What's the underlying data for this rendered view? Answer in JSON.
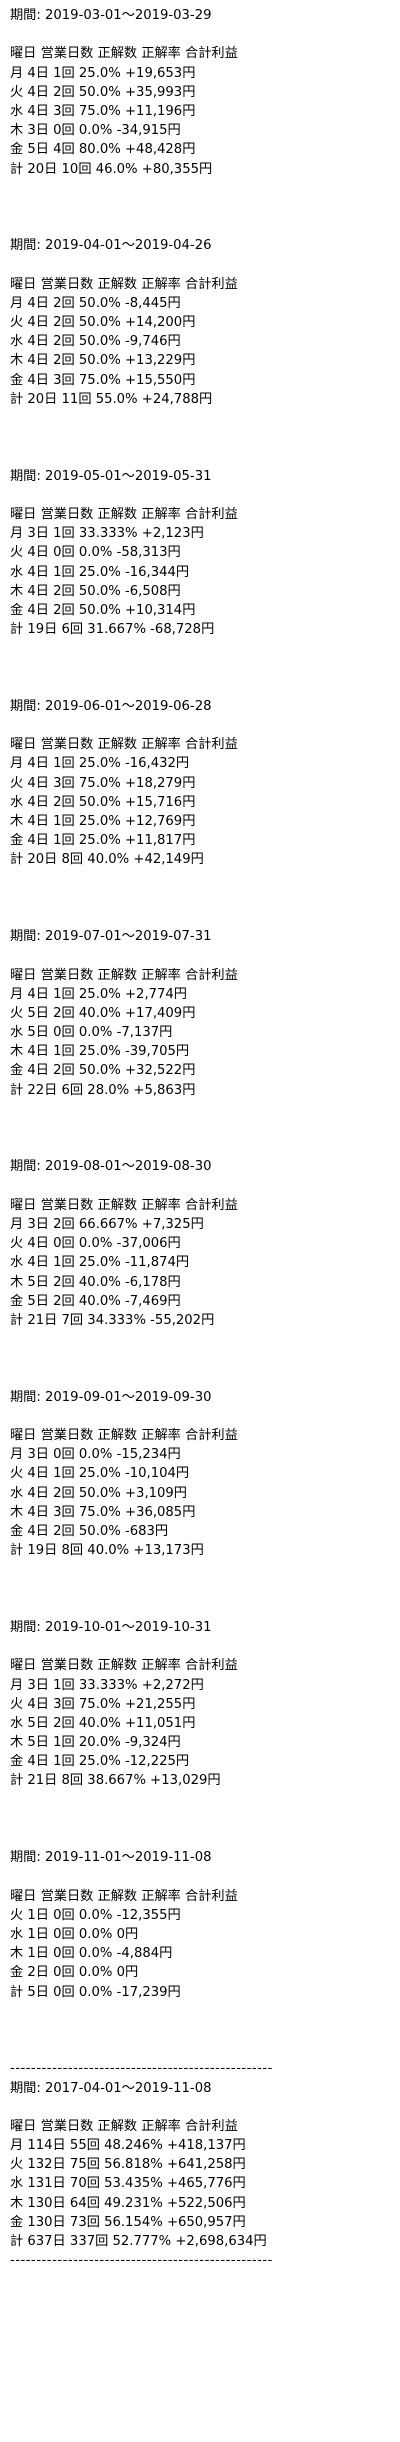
{
  "header_label": "曜日 営業日数 正解数 正解率 合計利益",
  "periods": [
    {
      "period": "期間: 2019-03-01～2019-03-29",
      "rows": [
        "月 4日 1回 25.0% +19,653円",
        "火 4日 2回 50.0% +35,993円",
        "水 4日 3回 75.0% +11,196円",
        "木 3日 0回 0.0% -34,915円",
        "金 5日 4回 80.0% +48,428円",
        "計 20日 10回 46.0% +80,355円"
      ]
    },
    {
      "period": "期間: 2019-04-01～2019-04-26",
      "rows": [
        "月 4日 2回 50.0% -8,445円",
        "火 4日 2回 50.0% +14,200円",
        "水 4日 2回 50.0% -9,746円",
        "木 4日 2回 50.0% +13,229円",
        "金 4日 3回 75.0% +15,550円",
        "計 20日 11回 55.0% +24,788円"
      ]
    },
    {
      "period": "期間: 2019-05-01～2019-05-31",
      "rows": [
        "月 3日 1回 33.333% +2,123円",
        "火 4日 0回 0.0% -58,313円",
        "水 4日 1回 25.0% -16,344円",
        "木 4日 2回 50.0% -6,508円",
        "金 4日 2回 50.0% +10,314円",
        "計 19日 6回 31.667% -68,728円"
      ]
    },
    {
      "period": "期間: 2019-06-01～2019-06-28",
      "rows": [
        "月 4日 1回 25.0% -16,432円",
        "火 4日 3回 75.0% +18,279円",
        "水 4日 2回 50.0% +15,716円",
        "木 4日 1回 25.0% +12,769円",
        "金 4日 1回 25.0% +11,817円",
        "計 20日 8回 40.0% +42,149円"
      ]
    },
    {
      "period": "期間: 2019-07-01～2019-07-31",
      "rows": [
        "月 4日 1回 25.0% +2,774円",
        "火 5日 2回 40.0% +17,409円",
        "水 5日 0回 0.0% -7,137円",
        "木 4日 1回 25.0% -39,705円",
        "金 4日 2回 50.0% +32,522円",
        "計 22日 6回 28.0% +5,863円"
      ]
    },
    {
      "period": "期間: 2019-08-01～2019-08-30",
      "rows": [
        "月 3日 2回 66.667% +7,325円",
        "火 4日 0回 0.0% -37,006円",
        "水 4日 1回 25.0% -11,874円",
        "木 5日 2回 40.0% -6,178円",
        "金 5日 2回 40.0% -7,469円",
        "計 21日 7回 34.333% -55,202円"
      ]
    },
    {
      "period": "期間: 2019-09-01～2019-09-30",
      "rows": [
        "月 3日 0回 0.0% -15,234円",
        "火 4日 1回 25.0% -10,104円",
        "水 4日 2回 50.0% +3,109円",
        "木 4日 3回 75.0% +36,085円",
        "金 4日 2回 50.0% -683円",
        "計 19日 8回 40.0% +13,173円"
      ]
    },
    {
      "period": "期間: 2019-10-01～2019-10-31",
      "rows": [
        "月 3日 1回 33.333% +2,272円",
        "火 4日 3回 75.0% +21,255円",
        "水 5日 2回 40.0% +11,051円",
        "木 5日 1回 20.0% -9,324円",
        "金 4日 1回 25.0% -12,225円",
        "計 21日 8回 38.667% +13,029円"
      ]
    },
    {
      "period": "期間: 2019-11-01～2019-11-08",
      "rows": [
        "火 1日 0回 0.0% -12,355円",
        "水 1日 0回 0.0% 0円",
        "木 1日 0回 0.0% -4,884円",
        "金 2日 0回 0.0% 0円",
        "計 5日 0回 0.0% -17,239円"
      ]
    }
  ],
  "divider": "--------------------------------------------------",
  "summary": {
    "period": "期間: 2017-04-01～2019-11-08",
    "rows": [
      "月 114日 55回 48.246% +418,137円",
      "火 132日 75回 56.818% +641,258円",
      "水 131日 70回 53.435% +465,776円",
      "木 130日 64回 49.231% +522,506円",
      "金 130日 73回 56.154% +650,957円",
      "計 637日 337回 52.777% +2,698,634円"
    ]
  },
  "bottom_divider": "--------------------------------------------------"
}
